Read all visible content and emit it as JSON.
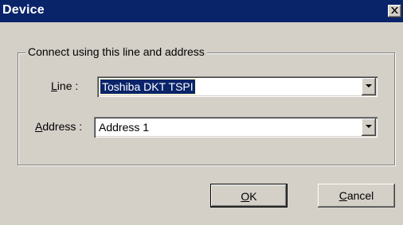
{
  "window": {
    "title": "Device",
    "close_glyph": "close-icon"
  },
  "group": {
    "legend": "Connect using this line and address"
  },
  "line_field": {
    "label_mnemonic": "L",
    "label_rest": "ine :",
    "value": "Toshiba DKT TSPI"
  },
  "address_field": {
    "label_mnemonic": "A",
    "label_rest": "ddress :",
    "value": "Address 1"
  },
  "buttons": {
    "ok_mnemonic": "O",
    "ok_rest": "K",
    "cancel_mnemonic": "C",
    "cancel_rest": "ancel"
  },
  "colors": {
    "titlebar": "#0a246a",
    "face": "#d4d0c8",
    "selection": "#0a246a"
  }
}
